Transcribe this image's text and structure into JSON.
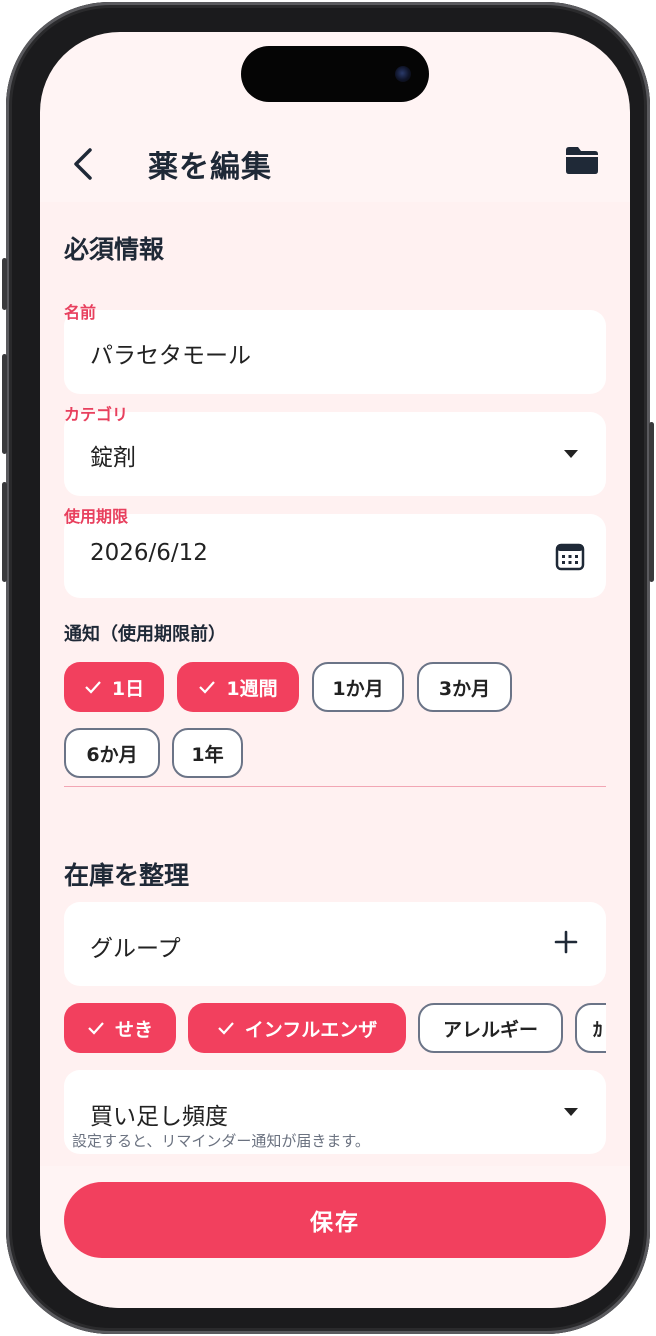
{
  "header": {
    "title": "薬を編集"
  },
  "required": {
    "title": "必須情報",
    "name": {
      "label": "名前",
      "value": "パラセタモール"
    },
    "category": {
      "label": "カテゴリ",
      "value": "錠剤"
    },
    "expiry": {
      "label": "使用期限",
      "value": "2026/6/12"
    },
    "notify": {
      "title": "通知（使用期限前）",
      "options": [
        {
          "label": "1日",
          "selected": true
        },
        {
          "label": "1週間",
          "selected": true
        },
        {
          "label": "1か月",
          "selected": false
        },
        {
          "label": "3か月",
          "selected": false
        },
        {
          "label": "6か月",
          "selected": false
        },
        {
          "label": "1年",
          "selected": false
        }
      ]
    }
  },
  "organize": {
    "title": "在庫を整理",
    "group_label": "グループ",
    "tags": [
      {
        "label": "せき",
        "selected": true
      },
      {
        "label": "インフルエンザ",
        "selected": true
      },
      {
        "label": "アレルギー",
        "selected": false
      },
      {
        "label": "ｶ",
        "selected": false
      }
    ],
    "refill": {
      "label": "買い足し頻度"
    },
    "hint": "設定すると、リマインダー通知が届きます。"
  },
  "footer": {
    "save_label": "保存"
  },
  "colors": {
    "accent": "#f2405e",
    "background": "#fff1f1",
    "text": "#1f2937"
  },
  "icons": [
    "back-chevron-icon",
    "folder-icon",
    "calendar-icon",
    "plus-icon",
    "check-icon",
    "caret-down-icon"
  ]
}
